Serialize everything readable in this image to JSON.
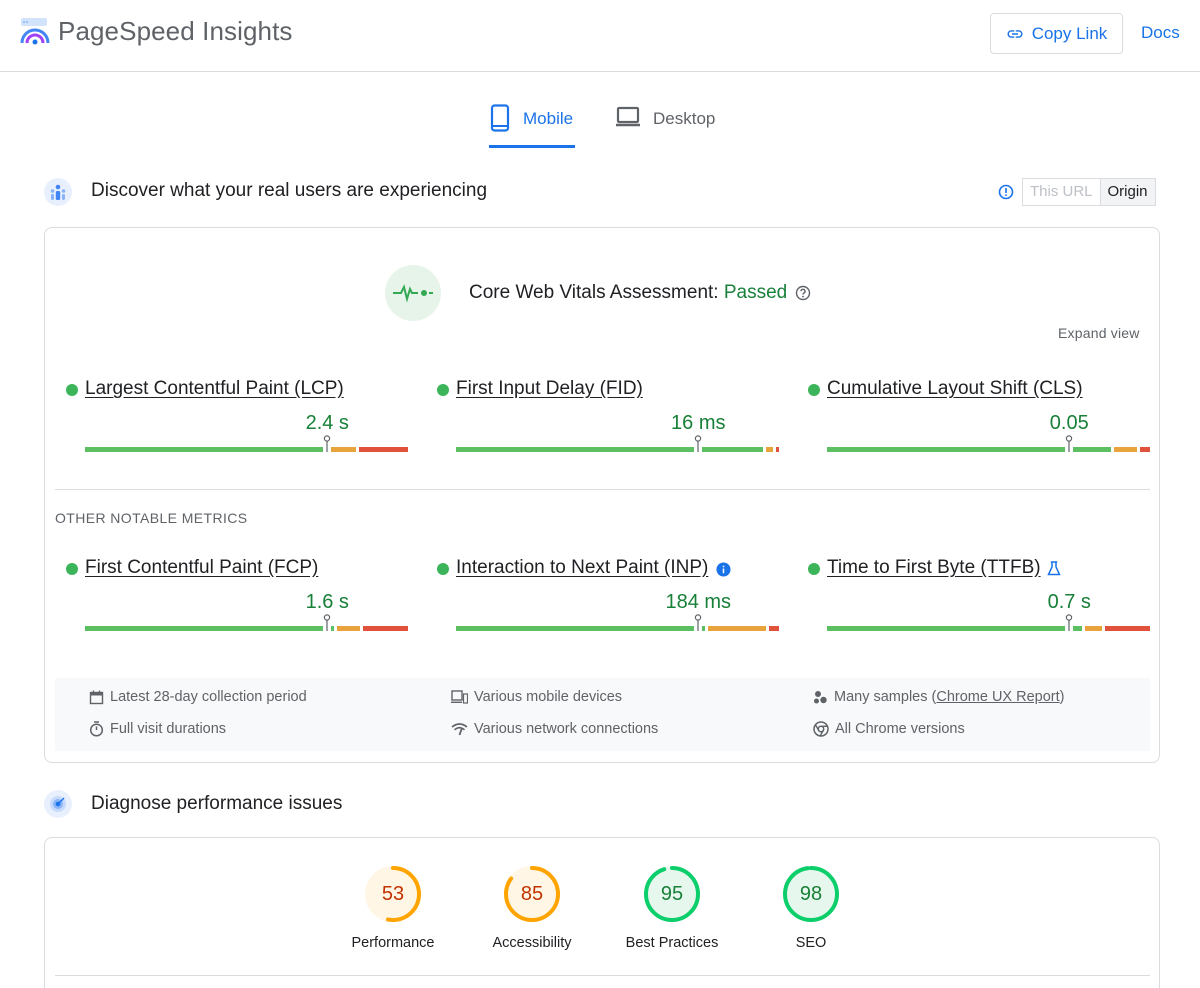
{
  "header": {
    "brand": "PageSpeed Insights",
    "copy_link": "Copy Link",
    "docs": "Docs"
  },
  "tabs": [
    {
      "label": "Mobile",
      "selected": true
    },
    {
      "label": "Desktop",
      "selected": false
    }
  ],
  "field": {
    "title": "Discover what your real users are experiencing",
    "toggle": {
      "this_url": "This URL",
      "origin": "Origin",
      "selected": "Origin"
    },
    "assessment_label": "Core Web Vitals Assessment: ",
    "assessment_result": "Passed",
    "expand": "Expand view",
    "core_metrics": [
      {
        "name": "Largest Contentful Paint (LCP)",
        "value": "2.4 s",
        "distribution": [
          0.75,
          0.09,
          0.16
        ],
        "marker": 0.75
      },
      {
        "name": "First Input Delay (FID)",
        "value": "16 ms",
        "distribution": [
          0.95,
          0.03,
          0.02
        ],
        "marker": 0.75
      },
      {
        "name": "Cumulative Layout Shift (CLS)",
        "value": "0.05",
        "distribution": [
          0.88,
          0.08,
          0.04
        ],
        "marker": 0.75
      }
    ],
    "other_label": "OTHER NOTABLE METRICS",
    "other_metrics": [
      {
        "name": "First Contentful Paint (FCP)",
        "value": "1.6 s",
        "distribution": [
          0.77,
          0.08,
          0.15
        ],
        "marker": 0.75
      },
      {
        "name": "Interaction to Next Paint (INP)",
        "value": "184 ms",
        "distribution": [
          0.77,
          0.19,
          0.04
        ],
        "marker": 0.75
      },
      {
        "name": "Time to First Byte (TTFB)",
        "value": "0.7 s",
        "distribution": [
          0.79,
          0.06,
          0.15
        ],
        "marker": 0.75
      }
    ],
    "info": {
      "collection_period": "Latest 28-day collection period",
      "devices": "Various mobile devices",
      "samples_prefix": "Many samples (",
      "samples_link": "Chrome UX Report",
      "samples_suffix": ")",
      "durations": "Full visit durations",
      "network": "Various network connections",
      "versions": "All Chrome versions"
    }
  },
  "lab": {
    "title": "Diagnose performance issues",
    "scores": [
      {
        "label": "Performance",
        "value": "53",
        "status": "average"
      },
      {
        "label": "Accessibility",
        "value": "85",
        "status": "average"
      },
      {
        "label": "Best Practices",
        "value": "95",
        "status": "good"
      },
      {
        "label": "SEO",
        "value": "98",
        "status": "good"
      }
    ]
  },
  "colors": {
    "accent": "#1a73e8",
    "good": "#0cce6b",
    "good_text": "#188038",
    "average": "#ffa400",
    "average_text": "#c33300",
    "poor": "#ff4e42",
    "bar_good": "#5cbf61",
    "bar_average": "#e8a33d",
    "bar_poor": "#e1523d"
  },
  "icons": [
    "psi-logo-icon",
    "link-icon",
    "phone-icon",
    "laptop-icon",
    "users-icon",
    "info-icon",
    "vitals-pulse-icon",
    "help-icon",
    "calendar-icon",
    "devices-icon",
    "samples-icon",
    "stopwatch-icon",
    "wifi-icon",
    "chrome-icon",
    "radar-icon",
    "flask-icon"
  ]
}
